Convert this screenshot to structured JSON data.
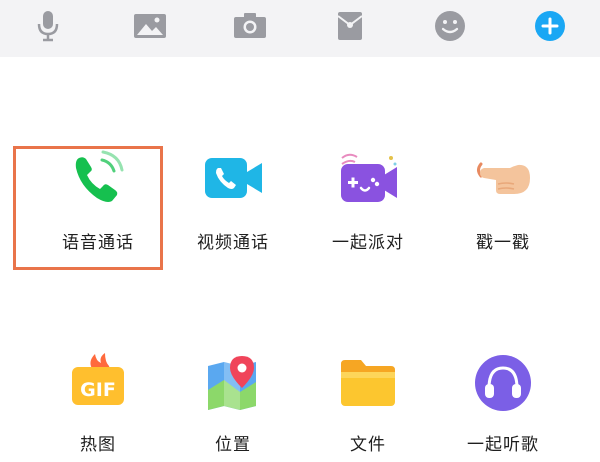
{
  "toolbar": {
    "icons": [
      "microphone-icon",
      "image-icon",
      "camera-icon",
      "red-packet-icon",
      "emoji-icon",
      "add-icon"
    ],
    "accent": "#1aa7f4"
  },
  "panel": {
    "items": [
      {
        "label": "语音通话",
        "icon": "voice-call-icon"
      },
      {
        "label": "视频通话",
        "icon": "video-call-icon"
      },
      {
        "label": "一起派对",
        "icon": "party-icon"
      },
      {
        "label": "戳一戳",
        "icon": "poke-icon"
      },
      {
        "label": "热图",
        "icon": "gif-icon"
      },
      {
        "label": "位置",
        "icon": "location-icon"
      },
      {
        "label": "文件",
        "icon": "folder-icon"
      },
      {
        "label": "一起听歌",
        "icon": "music-icon"
      }
    ],
    "highlight_color": "#e9744a"
  }
}
